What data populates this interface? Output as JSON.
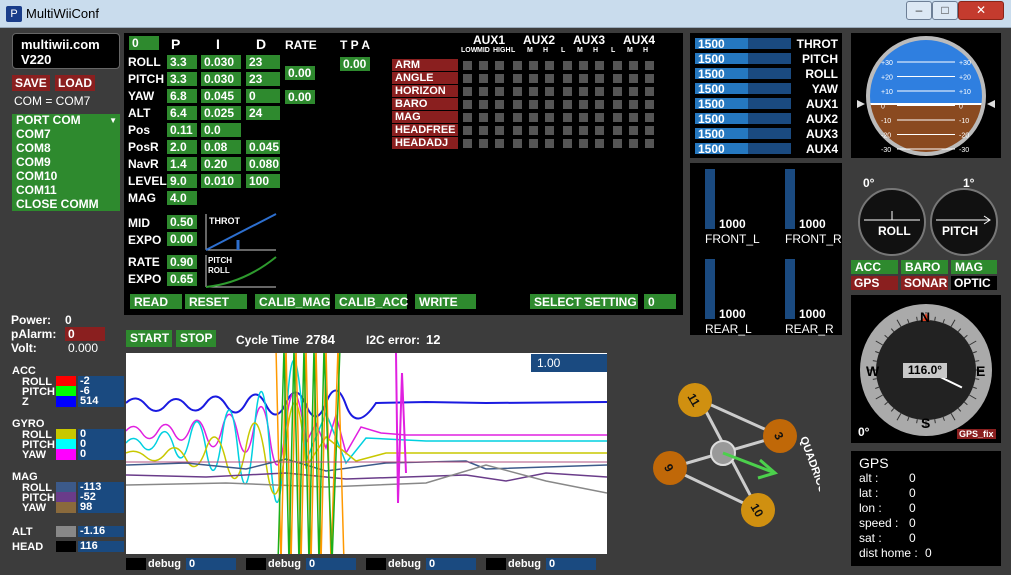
{
  "window": {
    "title": "MultiWiiConf",
    "app_icon": "P"
  },
  "header": {
    "brand": "multiwii.com",
    "version": "V220",
    "save": "SAVE",
    "load": "LOAD",
    "com_status": "COM = COM7"
  },
  "ports": {
    "title": "PORT COM",
    "items": [
      "COM7",
      "COM8",
      "COM9",
      "COM10",
      "COM11",
      "CLOSE COMM"
    ]
  },
  "power": {
    "power_label": "Power:",
    "power": "0",
    "palarm_label": "pAlarm:",
    "palarm": "0",
    "volt_label": "Volt:",
    "volt": "0.000"
  },
  "pid": {
    "setting": "0",
    "col_p": "P",
    "col_i": "I",
    "col_d": "D",
    "col_rate": "RATE",
    "col_tpa": "T P A",
    "rows": [
      {
        "name": "ROLL",
        "p": "3.3",
        "i": "0.030",
        "d": "23"
      },
      {
        "name": "PITCH",
        "p": "3.3",
        "i": "0.030",
        "d": "23"
      },
      {
        "name": "YAW",
        "p": "6.8",
        "i": "0.045",
        "d": "0"
      },
      {
        "name": "ALT",
        "p": "6.4",
        "i": "0.025",
        "d": "24"
      },
      {
        "name": "Pos",
        "p": "0.11",
        "i": "0.0",
        "d": ""
      },
      {
        "name": "PosR",
        "p": "2.0",
        "i": "0.08",
        "d": "0.045"
      },
      {
        "name": "NavR",
        "p": "1.4",
        "i": "0.20",
        "d": "0.080"
      },
      {
        "name": "LEVEL",
        "p": "9.0",
        "i": "0.010",
        "d": "100"
      },
      {
        "name": "MAG",
        "p": "4.0",
        "i": "",
        "d": ""
      }
    ],
    "rate_rollpitch": "0.00",
    "rate_yaw": "0.00",
    "tpa": "0.00",
    "mid_label": "MID",
    "mid": "0.50",
    "expo_label": "EXPO",
    "expo": "0.00",
    "throt_label": "THROT",
    "rate_label": "RATE",
    "rate": "0.90",
    "expo2_label": "EXPO",
    "expo2": "0.65",
    "pitch_label": "PITCH",
    "roll_label": "ROLL"
  },
  "aux": {
    "headers": [
      "AUX1",
      "AUX2",
      "AUX3",
      "AUX4"
    ],
    "sub1": [
      "LOW",
      "MID",
      "HIGH"
    ],
    "sub": [
      "L",
      "M",
      "H"
    ],
    "modes": [
      "ARM",
      "ANGLE",
      "HORIZON",
      "BARO",
      "MAG",
      "HEADFREE",
      "HEADADJ"
    ]
  },
  "actions": {
    "read": "READ",
    "reset": "RESET",
    "calib_mag": "CALIB_MAG",
    "calib_acc": "CALIB_ACC",
    "write": "WRITE",
    "select_setting": "SELECT SETTING",
    "select_value": "0"
  },
  "rc": {
    "channels": [
      {
        "name": "THROT",
        "value": "1500",
        "fill": 0.55
      },
      {
        "name": "PITCH",
        "value": "1500",
        "fill": 0.55
      },
      {
        "name": "ROLL",
        "value": "1500",
        "fill": 0.55
      },
      {
        "name": "YAW",
        "value": "1500",
        "fill": 0.55
      },
      {
        "name": "AUX1",
        "value": "1500",
        "fill": 0.55
      },
      {
        "name": "AUX2",
        "value": "1500",
        "fill": 0.55
      },
      {
        "name": "AUX3",
        "value": "1500",
        "fill": 0.55
      },
      {
        "name": "AUX4",
        "value": "1500",
        "fill": 0.55
      }
    ]
  },
  "motors": [
    {
      "name": "FRONT_L",
      "value": "1000"
    },
    {
      "name": "FRONT_R",
      "value": "1000"
    },
    {
      "name": "REAR_L",
      "value": "1000"
    },
    {
      "name": "REAR_R",
      "value": "1000"
    }
  ],
  "horizon": {
    "ticks": [
      "+30",
      "+20",
      "+10",
      "0",
      "-10",
      "-20",
      "-30"
    ],
    "roll_angle": "0°",
    "pitch_angle": "1°",
    "roll_label": "ROLL",
    "pitch_label": "PITCH"
  },
  "sensors": {
    "acc": "ACC",
    "baro": "BARO",
    "mag": "MAG",
    "gps": "GPS",
    "sonar": "SONAR",
    "optic": "OPTIC",
    "colors": {
      "on": "#2e8a2e",
      "off": "#8a1f1f",
      "none": "#000000"
    }
  },
  "compass": {
    "heading": "116.0°",
    "n": "N",
    "e": "E",
    "s": "S",
    "w": "W",
    "angle": "0°",
    "gps_fix": "GPS_fix",
    "heading_deg": 116
  },
  "gps": {
    "title": "GPS",
    "rows": [
      {
        "label": "alt :",
        "value": "0"
      },
      {
        "label": "lat :",
        "value": "0"
      },
      {
        "label": "lon :",
        "value": "0"
      },
      {
        "label": "speed :",
        "value": "0"
      },
      {
        "label": "sat :",
        "value": "0"
      },
      {
        "label": "dist home :",
        "value": "0"
      }
    ]
  },
  "graph": {
    "start": "START",
    "stop": "STOP",
    "cycle_label": "Cycle Time",
    "cycle": "2784",
    "i2c_label": "I2C error:",
    "i2c": "12",
    "scale": "1.00"
  },
  "legend": {
    "acc": {
      "title": "ACC",
      "rows": [
        {
          "name": "ROLL",
          "value": "-2",
          "color": "#ff0000"
        },
        {
          "name": "PITCH",
          "value": "-6",
          "color": "#00ff00"
        },
        {
          "name": "Z",
          "value": "514",
          "color": "#0000ff"
        }
      ]
    },
    "gyro": {
      "title": "GYRO",
      "rows": [
        {
          "name": "ROLL",
          "value": "0",
          "color": "#c8c800"
        },
        {
          "name": "PITCH",
          "value": "0",
          "color": "#00ffff"
        },
        {
          "name": "YAW",
          "value": "0",
          "color": "#ff00ff"
        }
      ]
    },
    "mag": {
      "title": "MAG",
      "rows": [
        {
          "name": "ROLL",
          "value": "-113",
          "color": "#3c5a8a"
        },
        {
          "name": "PITCH",
          "value": "-52",
          "color": "#6a3c8a"
        },
        {
          "name": "YAW",
          "value": "98",
          "color": "#8a6a3c"
        }
      ]
    },
    "alt": {
      "name": "ALT",
      "value": "-1.16",
      "color": "#888888"
    },
    "head": {
      "name": "HEAD",
      "value": "116",
      "color": "#000000"
    }
  },
  "debug": [
    {
      "label": "debug",
      "value": "0"
    },
    {
      "label": "debug",
      "value": "0"
    },
    {
      "label": "debug",
      "value": "0"
    },
    {
      "label": "debug",
      "value": "0"
    }
  ],
  "quad": {
    "type": "QUADRICOPTER X",
    "motors": [
      "11",
      "3",
      "9",
      "10"
    ]
  }
}
